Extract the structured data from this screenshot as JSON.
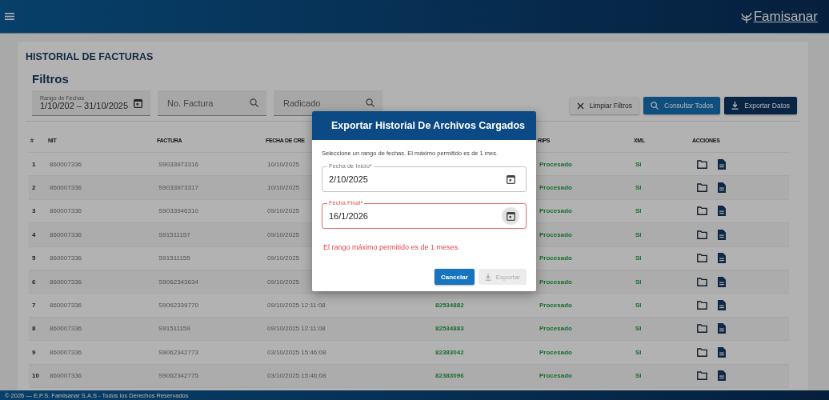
{
  "header": {
    "logo": "Famisanar"
  },
  "page_title": "HISTORIAL DE FACTURAS",
  "filters": {
    "title": "Filtros",
    "date_range": {
      "label": "Rango de Fechas",
      "value": "1/10/202 – 31/10/2025"
    },
    "invoice_search": {
      "placeholder": "No. Factura"
    },
    "filed_search": {
      "placeholder": "Radicado"
    }
  },
  "actions": [
    {
      "label": "Limpiar Filtros",
      "kind": "clear"
    },
    {
      "label": "Consultar Todos",
      "kind": "search"
    },
    {
      "label": "Exportar Datos",
      "kind": "export"
    }
  ],
  "table": {
    "columns": [
      "#",
      "NIT",
      "FACTURA",
      "FECHA DE CRE",
      "RIPS",
      "XML",
      "ACCIONES"
    ],
    "rows": [
      {
        "num": "1",
        "nit": "860007336",
        "invoice": "S9033973316",
        "created": "10/10/2025",
        "rips": "Procesado",
        "xml": "SI"
      },
      {
        "num": "2",
        "nit": "860007336",
        "invoice": "S9033973317",
        "created": "10/10/2025",
        "rips": "Procesado",
        "xml": "SI"
      },
      {
        "num": "3",
        "nit": "860007336",
        "invoice": "S9033946310",
        "created": "09/10/2025",
        "rips": "Procesado",
        "xml": "SI"
      },
      {
        "num": "4",
        "nit": "860007336",
        "invoice": "S91511157",
        "created": "09/10/2025",
        "rips": "Procesado",
        "xml": "SI"
      },
      {
        "num": "5",
        "nit": "860007336",
        "invoice": "S91511155",
        "created": "09/10/2025",
        "rips": "Procesado",
        "xml": "SI"
      },
      {
        "num": "6",
        "nit": "860007336",
        "invoice": "S9062343634",
        "created": "09/10/2025",
        "rips": "Procesado",
        "xml": "SI"
      },
      {
        "num": "7",
        "nit": "860007336",
        "invoice": "S9062339770",
        "created": "09/10/2025 12:11:08",
        "filed": "82534882",
        "rips": "Procesado",
        "xml": "SI"
      },
      {
        "num": "8",
        "nit": "860007336",
        "invoice": "S91511159",
        "created": "09/10/2025 12:11:08",
        "filed": "82534883",
        "rips": "Procesado",
        "xml": "SI"
      },
      {
        "num": "9",
        "nit": "860007336",
        "invoice": "S9062342773",
        "created": "03/10/2025 15:46:08",
        "filed": "82383042",
        "rips": "Procesado",
        "xml": "SI"
      },
      {
        "num": "10",
        "nit": "860007336",
        "invoice": "S9062342775",
        "created": "03/10/2025 15:46:08",
        "filed": "82383096",
        "rips": "Procesado",
        "xml": "SI"
      }
    ]
  },
  "footer": "© 2026 — E.P.S. Famisanar S.A.S - Todos los Derechos Reservados",
  "dialog": {
    "title": "Exportar Historial De Archivos Cargados",
    "intro": "Seleccione un rango de fechas. El máximo permitido es de 1 mes.",
    "fields": [
      {
        "label": "Fecha de Inicio*",
        "value": "2/10/2025",
        "error": false,
        "calendar_hover": false
      },
      {
        "label": "Fecha Final*",
        "value": "16/1/2026",
        "error": true,
        "calendar_hover": true
      }
    ],
    "error": "El rango máximo permitido es de 1 meses.",
    "buttons": [
      {
        "label": "Cancelar",
        "kind": "cancel",
        "disabled": false
      },
      {
        "label": "Exportar",
        "kind": "export",
        "disabled": true
      }
    ]
  }
}
